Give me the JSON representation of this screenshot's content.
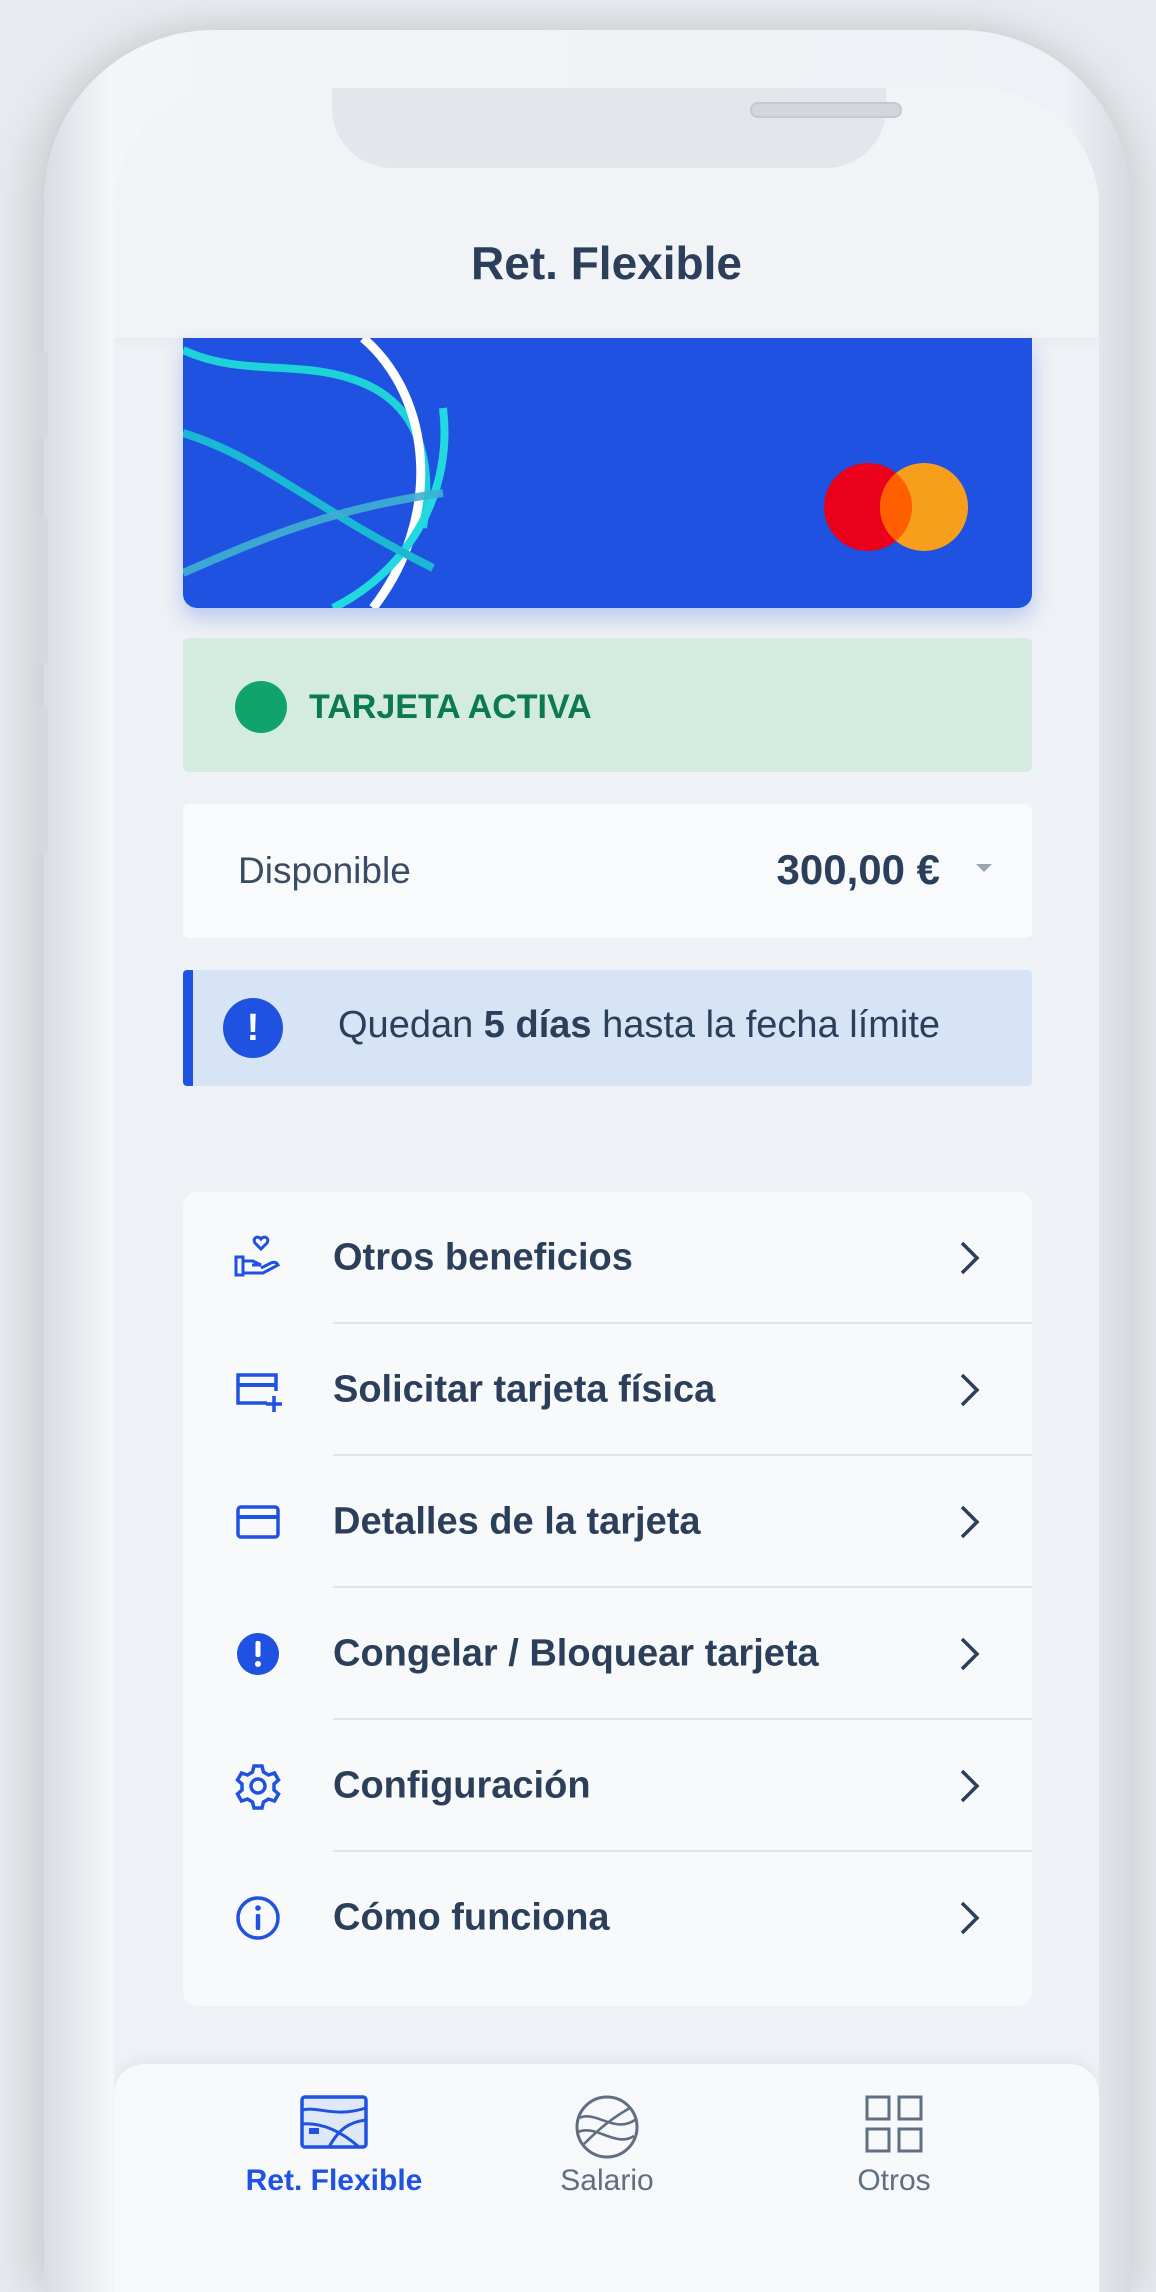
{
  "header": {
    "title": "Ret. Flexible"
  },
  "card": {
    "brand_icon": "mastercard-logo",
    "colors": {
      "card": "#1f52e0",
      "mc_red": "#eb001b",
      "mc_orange": "#f79e1b"
    }
  },
  "status": {
    "label": "TARJETA ACTIVA",
    "color": "#10a36b"
  },
  "available": {
    "label": "Disponible",
    "amount": "300,00 €"
  },
  "alert": {
    "prefix": "Quedan ",
    "highlight": "5 días",
    "suffix": " hasta la fecha límite"
  },
  "menu": {
    "items": [
      {
        "label": "Otros beneficios",
        "icon": "hand-heart-icon"
      },
      {
        "label": "Solicitar tarjeta física",
        "icon": "card-add-icon"
      },
      {
        "label": "Detalles de la tarjeta",
        "icon": "card-icon"
      },
      {
        "label": "Congelar / Bloquear tarjeta",
        "icon": "exclamation-icon"
      },
      {
        "label": "Configuración",
        "icon": "gear-icon"
      },
      {
        "label": "Cómo funciona",
        "icon": "info-icon"
      }
    ]
  },
  "nav": {
    "items": [
      {
        "label": "Ret. Flexible",
        "icon": "card-wave-icon",
        "active": true
      },
      {
        "label": "Salario",
        "icon": "globe-wave-icon",
        "active": false
      },
      {
        "label": "Otros",
        "icon": "grid-icon",
        "active": false
      }
    ]
  },
  "colors": {
    "accent": "#1f52e0",
    "text": "#2c3f5a",
    "status_bg": "#d3ebe0",
    "alert_bg": "#d6e4f5"
  }
}
